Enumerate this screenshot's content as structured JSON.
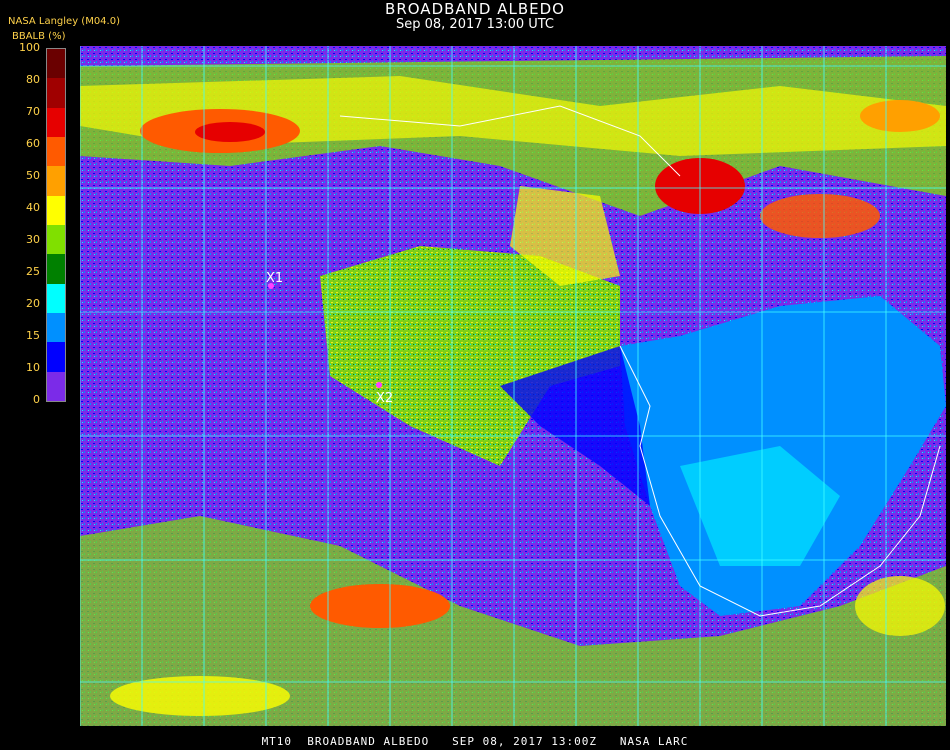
{
  "title": "BROADBAND ALBEDO",
  "subtitle": "Sep 08, 2017 13:00 UTC",
  "source_label": "NASA Langley (M04.0)",
  "legend": {
    "unit_label": "BBALB (%)",
    "ticks": [
      "100",
      "80",
      "70",
      "60",
      "50",
      "40",
      "30",
      "25",
      "20",
      "15",
      "10",
      "0"
    ],
    "colors": [
      "#6a0000",
      "#a00000",
      "#e60000",
      "#ff5a00",
      "#ffa000",
      "#ffff00",
      "#80e000",
      "#008000",
      "#00ffff",
      "#0090ff",
      "#0000ff",
      "#7b2be8"
    ]
  },
  "markers": [
    {
      "label": "X1",
      "color": "#ff40ff"
    },
    {
      "label": "X2",
      "color": "#ff40ff"
    }
  ],
  "footer": "MT10  BROADBAND ALBEDO   SEP 08, 2017 13:00Z   NASA LARC"
}
